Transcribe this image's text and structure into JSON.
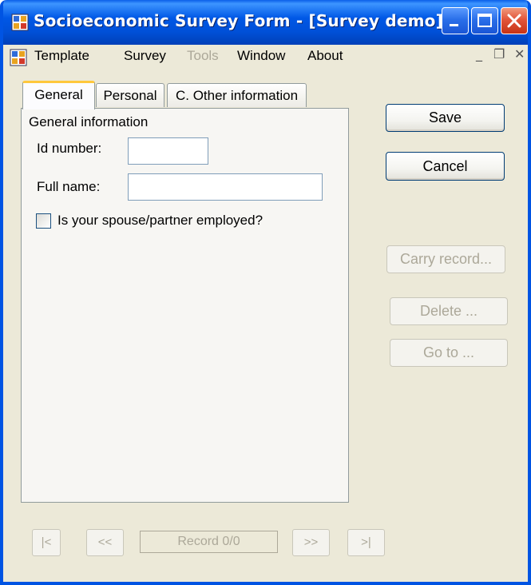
{
  "window": {
    "title": "Socioeconomic Survey Form - [Survey demo]",
    "accent_color": "#0054E3",
    "close_color": "#E2553A",
    "controls": [
      "minimize-icon",
      "maximize-icon",
      "close-icon"
    ]
  },
  "menubar": {
    "items": [
      {
        "label": "Template",
        "enabled": true
      },
      {
        "label": "Survey",
        "enabled": true
      },
      {
        "label": "Tools",
        "enabled": false
      },
      {
        "label": "Window",
        "enabled": true
      },
      {
        "label": "About",
        "enabled": true
      }
    ],
    "mdi_minimize": "_",
    "mdi_restore": "❐",
    "mdi_close": "✕"
  },
  "tabs": [
    {
      "label": "General",
      "active": true
    },
    {
      "label": "Personal",
      "active": false
    },
    {
      "label": "C. Other information",
      "active": false
    }
  ],
  "general": {
    "group_title": "General information",
    "id_label": "Id number:",
    "id_value": "",
    "fullname_label": "Full name:",
    "fullname_value": "",
    "spouse_label": "Is your spouse/partner employed?",
    "spouse_checked": false
  },
  "actions": {
    "save": "Save",
    "cancel": "Cancel",
    "carry": "Carry record...",
    "delete": "Delete ...",
    "goto": "Go to ..."
  },
  "navigation": {
    "first": "|<",
    "prev": "<<",
    "record": "Record 0/0",
    "next": ">>",
    "last": ">|"
  }
}
